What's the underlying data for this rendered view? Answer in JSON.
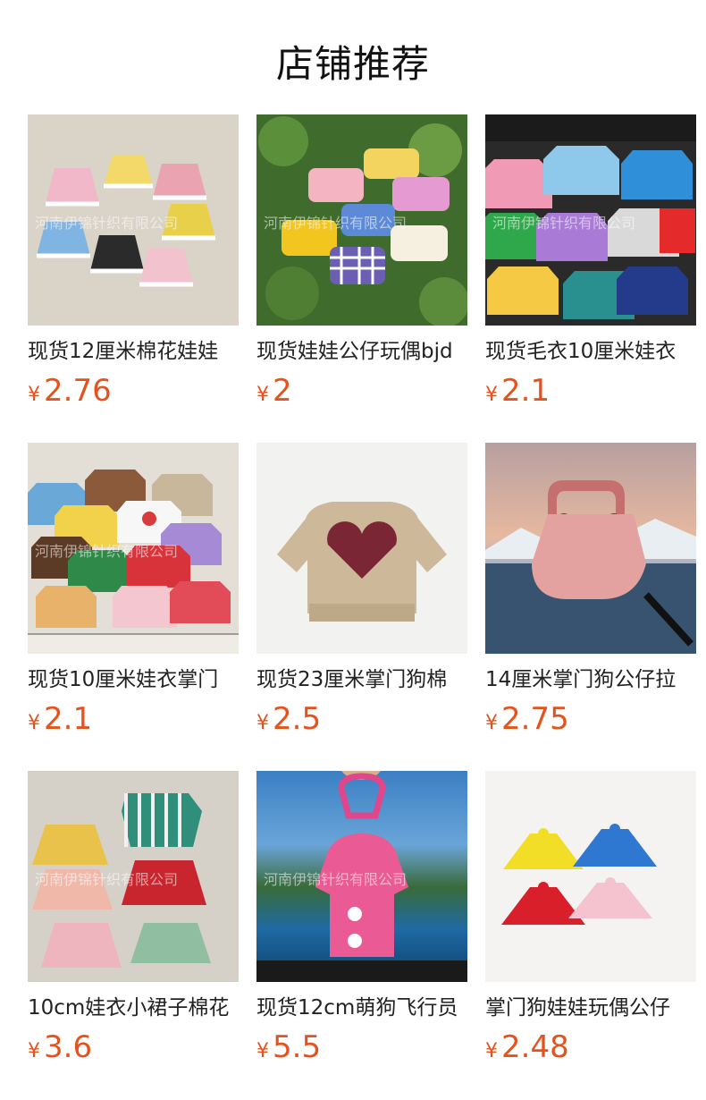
{
  "section": {
    "title": "店铺推荐"
  },
  "products": [
    {
      "name": "现货12厘米棉花娃娃",
      "currency": "¥",
      "price": "2.76",
      "watermark": "河南伊锦针织有限公司"
    },
    {
      "name": "现货娃娃公仔玩偶bjd",
      "currency": "¥",
      "price": "2",
      "watermark": "河南伊锦针织有限公司"
    },
    {
      "name": "现货毛衣10厘米娃衣",
      "currency": "¥",
      "price": "2.1",
      "watermark": "河南伊锦针织有限公司"
    },
    {
      "name": "现货10厘米娃衣掌门",
      "currency": "¥",
      "price": "2.1",
      "watermark": "河南伊锦针织有限公司"
    },
    {
      "name": "现货23厘米掌门狗棉",
      "currency": "¥",
      "price": "2.5",
      "watermark": ""
    },
    {
      "name": "14厘米掌门狗公仔拉",
      "currency": "¥",
      "price": "2.75",
      "watermark": ""
    },
    {
      "name": "10cm娃衣小裙子棉花",
      "currency": "¥",
      "price": "3.6",
      "watermark": "河南伊锦针织有限公司"
    },
    {
      "name": "现货12cm萌狗飞行员",
      "currency": "¥",
      "price": "5.5",
      "watermark": "河南伊锦针织有限公司"
    },
    {
      "name": "掌门狗娃娃玩偶公仔",
      "currency": "¥",
      "price": "2.48",
      "watermark": ""
    }
  ]
}
